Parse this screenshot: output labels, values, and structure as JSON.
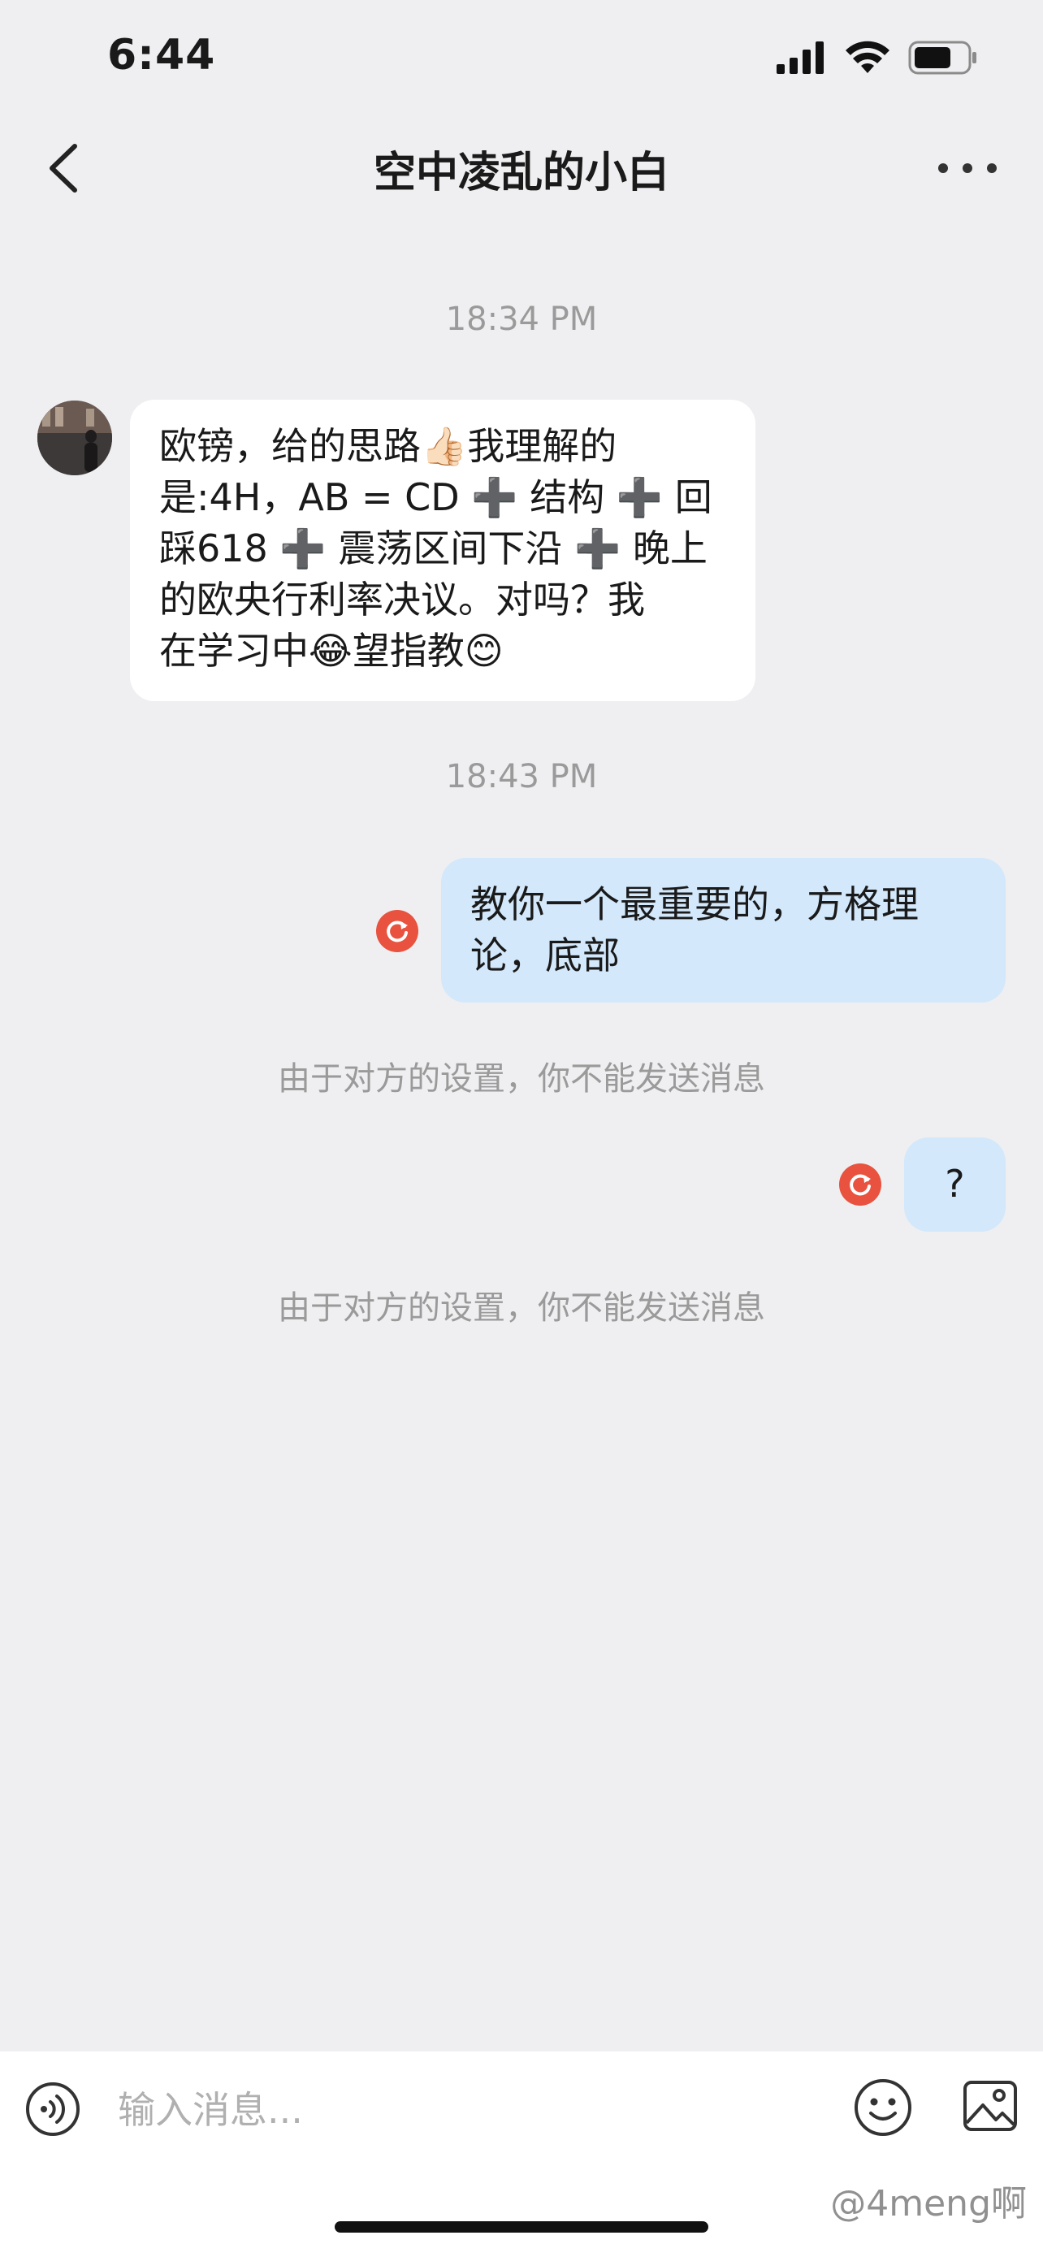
{
  "status_bar": {
    "time": "6:44"
  },
  "header": {
    "title": "空中凌乱的小白"
  },
  "messages": [
    {
      "type": "timestamp",
      "text": "18:34 PM"
    },
    {
      "type": "incoming",
      "lines": [
        "欧镑，给的思路👍🏻我理解的",
        "是:4H，AB = CD ➕ 结构 ➕ 回",
        "踩618 ➕ 震荡区间下沿 ➕ 晚上",
        "的欧央行利率决议。对吗？我",
        "在学习中😂望指教😊"
      ]
    },
    {
      "type": "timestamp",
      "text": "18:43 PM"
    },
    {
      "type": "outgoing",
      "lines": [
        "教你一个最重要的，方格理",
        "论，底部"
      ],
      "failed": true
    },
    {
      "type": "system",
      "text": "由于对方的设置，你不能发送消息"
    },
    {
      "type": "outgoing",
      "lines": [
        "?"
      ],
      "failed": true
    },
    {
      "type": "system",
      "text": "由于对方的设置，你不能发送消息"
    }
  ],
  "input_bar": {
    "placeholder": "输入消息..."
  },
  "watermark": "@4meng啊",
  "colors": {
    "background": "#efeff1",
    "outgoing_bubble": "#d3e8fb",
    "resend_icon": "#e8523f"
  }
}
